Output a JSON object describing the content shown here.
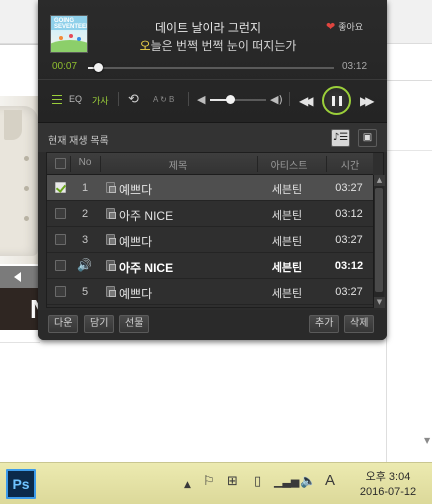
{
  "now_playing": {
    "lyric_line1": "데이트 날이라 그런지",
    "lyric_line2_highlight": "오",
    "lyric_line2_rest": "늘은 번쩍 번쩍 눈이 떠지는가",
    "like_label": "좋아요",
    "elapsed": "00:07",
    "duration": "03:12",
    "progress_fraction": 0.04,
    "album_art_text": "GOING SEVENTEEN"
  },
  "controls": {
    "playlist_icon": "list-icon",
    "eq_label": "EQ",
    "lyrics_label": "가사",
    "repeat_icon": "repeat-icon",
    "ab_repeat_label": "A ↻ B",
    "volume_fraction": 0.35,
    "accent_color": "#9bcf3a"
  },
  "playlist": {
    "title": "현재 재생 목록",
    "columns": {
      "no": "No",
      "title": "제목",
      "artist": "아티스트",
      "time": "시간"
    },
    "rows": [
      {
        "no": "1",
        "title": "예쁘다",
        "artist": "세븐틴",
        "time": "03:27",
        "checked": true,
        "selected": true,
        "playing": false
      },
      {
        "no": "2",
        "title": "아주 NICE",
        "artist": "세븐틴",
        "time": "03:12",
        "checked": false,
        "selected": false,
        "playing": false
      },
      {
        "no": "3",
        "title": "예쁘다",
        "artist": "세븐틴",
        "time": "03:27",
        "checked": false,
        "selected": false,
        "playing": false
      },
      {
        "no": "",
        "title": "아주 NICE",
        "artist": "세븐틴",
        "time": "03:12",
        "checked": false,
        "selected": false,
        "playing": true
      },
      {
        "no": "5",
        "title": "예쁘다",
        "artist": "세븐틴",
        "time": "03:27",
        "checked": false,
        "selected": false,
        "playing": false
      }
    ],
    "buttons": {
      "download": "다운",
      "save": "담기",
      "gift": "선물",
      "add": "추가",
      "delete": "삭제"
    }
  },
  "taskbar": {
    "app_label": "Ps",
    "ime_label": "A",
    "time": "오후 3:04",
    "date": "2016-07-12"
  }
}
